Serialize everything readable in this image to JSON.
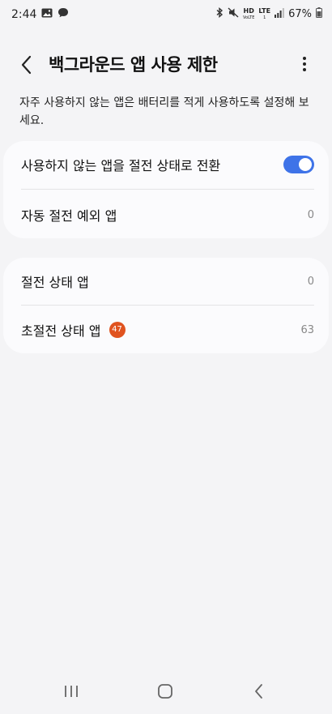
{
  "status": {
    "time": "2:44",
    "battery": "67%",
    "hd_label": "HD",
    "hd_sub": "VoLTE",
    "lte_label": "LTE",
    "lte_sub": "1"
  },
  "header": {
    "title": "백그라운드 앱 사용 제한"
  },
  "description": "자주 사용하지 않는 앱은 배터리를 적게 사용하도록 설정해 보세요.",
  "card1": {
    "toggle_label": "사용하지 않는 앱을 절전 상태로 전환",
    "toggle_on": true,
    "exceptions_label": "자동 절전 예외 앱",
    "exceptions_count": "0"
  },
  "card2": {
    "sleeping_label": "절전 상태 앱",
    "sleeping_count": "0",
    "deep_sleeping_label": "초절전 상태 앱",
    "deep_sleeping_badge": "47",
    "deep_sleeping_count": "63"
  },
  "colors": {
    "accent": "#3e73e8",
    "badge": "#e0531f",
    "background": "#f4f4f6",
    "card": "#fbfbfd"
  },
  "icons": [
    "image-icon",
    "message-icon",
    "bluetooth-icon",
    "mute-icon",
    "signal-icon",
    "battery-icon",
    "back-arrow-icon",
    "more-options-icon",
    "recent-apps-icon",
    "home-icon",
    "nav-back-icon"
  ]
}
